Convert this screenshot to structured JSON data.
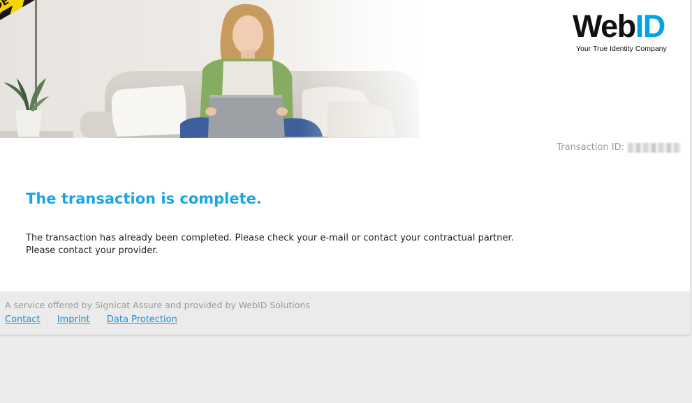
{
  "hero": {
    "testmode_label": "MODE TESTMODE",
    "alt": ""
  },
  "logo": {
    "web": "Web",
    "id": "ID",
    "tagline": "Your True Identity Company"
  },
  "transaction": {
    "label": "Transaction ID:"
  },
  "main": {
    "title": "The transaction is complete.",
    "line1": "The transaction has already been completed. Please check your e-mail or contact your contractual partner.",
    "line2": "Please contact your provider."
  },
  "footer": {
    "text": "A service offered by Signicat Assure and provided by WebID Solutions",
    "links": [
      "Contact",
      "Imprint",
      "Data Protection"
    ]
  },
  "colors": {
    "accent": "#1aa6e6",
    "logo_blue": "#00a4e4",
    "tape_yellow": "#f6d400",
    "footer_bg": "#ebebeb",
    "page_bg": "#ececec"
  }
}
